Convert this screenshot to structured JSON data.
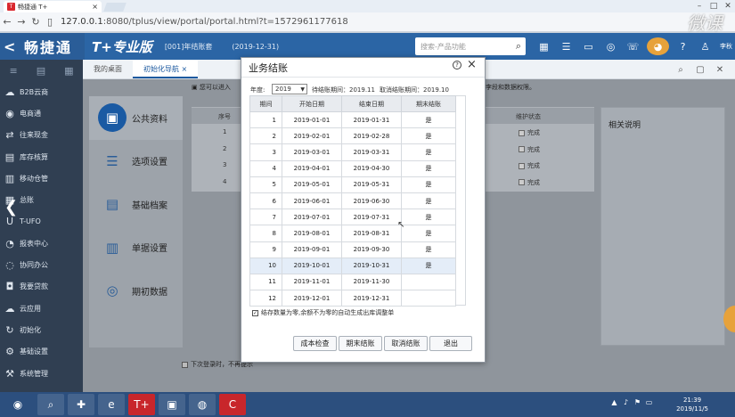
{
  "browser": {
    "tab_title": "畅捷通 T+",
    "tab_close": "×",
    "url_host": "127.0.0.1",
    "url_rest": ":8080/tplus/view/portal/portal.html?t=1572961177618",
    "watermark": "微课"
  },
  "app": {
    "logo": "畅捷通",
    "product": "T+专业版",
    "account": "[001]年结账套",
    "account_date": "(2019-12-31)",
    "search_placeholder": "搜索-产品功能",
    "user": "李秋"
  },
  "sidebar": {
    "items": [
      {
        "label": "B2B云商",
        "icon": "b2b-icon"
      },
      {
        "label": "电商通",
        "icon": "ecommerce-icon"
      },
      {
        "label": "往来现金",
        "icon": "cash-icon"
      },
      {
        "label": "库存核算",
        "icon": "inventory-icon"
      },
      {
        "label": "移动仓管",
        "icon": "mobile-warehouse-icon"
      },
      {
        "label": "总账",
        "icon": "ledger-icon"
      },
      {
        "label": "T-UFO",
        "icon": "ufo-icon"
      },
      {
        "label": "报表中心",
        "icon": "report-icon"
      },
      {
        "label": "协同办公",
        "icon": "collab-icon"
      },
      {
        "label": "我要贷款",
        "icon": "loan-icon"
      },
      {
        "label": "云应用",
        "icon": "cloud-icon"
      },
      {
        "label": "初始化",
        "icon": "init-icon"
      },
      {
        "label": "基础设置",
        "icon": "settings-icon"
      },
      {
        "label": "系统管理",
        "icon": "system-icon"
      }
    ]
  },
  "content_tabs": {
    "tab1": "我的桌面",
    "tab2": "初始化导航",
    "tab2_close": "×"
  },
  "notice": {
    "text": "您可以进入",
    "text2": "李段和数据权限。"
  },
  "left_panel": {
    "items": [
      {
        "label": "公共资料",
        "icon": "briefcase-icon"
      },
      {
        "label": "选项设置",
        "icon": "list-icon"
      },
      {
        "label": "基础档案",
        "icon": "archive-icon"
      },
      {
        "label": "单据设置",
        "icon": "document-icon"
      },
      {
        "label": "期初数据",
        "icon": "data-icon"
      }
    ]
  },
  "main_grid": {
    "col_no": "序号",
    "col_maint": "维护状态",
    "rows": [
      {
        "no": "1",
        "status": "完成"
      },
      {
        "no": "2",
        "status": "完成"
      },
      {
        "no": "3",
        "status": "完成"
      },
      {
        "no": "4",
        "status": "完成"
      }
    ]
  },
  "related": {
    "title": "相关说明"
  },
  "footer": {
    "checkbox_label": "下次登录时，不再提示"
  },
  "modal": {
    "title": "业务结账",
    "help": "?",
    "close": "×",
    "year_label": "年度:",
    "year_value": "2019",
    "pending_period": "待结账期间：2019.11",
    "cancel_period": "取消结账期间：2019.10",
    "table": {
      "headers": [
        "期间",
        "开始日期",
        "结束日期",
        "期末结账"
      ],
      "rows": [
        {
          "period": "1",
          "start": "2019-01-01",
          "end": "2019-01-31",
          "closed": "是"
        },
        {
          "period": "2",
          "start": "2019-02-01",
          "end": "2019-02-28",
          "closed": "是"
        },
        {
          "period": "3",
          "start": "2019-03-01",
          "end": "2019-03-31",
          "closed": "是"
        },
        {
          "period": "4",
          "start": "2019-04-01",
          "end": "2019-04-30",
          "closed": "是"
        },
        {
          "period": "5",
          "start": "2019-05-01",
          "end": "2019-05-31",
          "closed": "是"
        },
        {
          "period": "6",
          "start": "2019-06-01",
          "end": "2019-06-30",
          "closed": "是"
        },
        {
          "period": "7",
          "start": "2019-07-01",
          "end": "2019-07-31",
          "closed": "是"
        },
        {
          "period": "8",
          "start": "2019-08-01",
          "end": "2019-08-31",
          "closed": "是"
        },
        {
          "period": "9",
          "start": "2019-09-01",
          "end": "2019-09-30",
          "closed": "是"
        },
        {
          "period": "10",
          "start": "2019-10-01",
          "end": "2019-10-31",
          "closed": "是"
        },
        {
          "period": "11",
          "start": "2019-11-01",
          "end": "2019-11-30",
          "closed": ""
        },
        {
          "period": "12",
          "start": "2019-12-01",
          "end": "2019-12-31",
          "closed": ""
        }
      ],
      "selected_row": 10
    },
    "checkbox_label": "结存数量为零,余额不为零的自动生成出库调整单",
    "buttons": {
      "check": "成本检查",
      "close_period": "期末结账",
      "cancel_close": "取消结账",
      "exit": "退出"
    }
  },
  "taskbar": {
    "time": "21:39",
    "date": "2019/11/5"
  }
}
